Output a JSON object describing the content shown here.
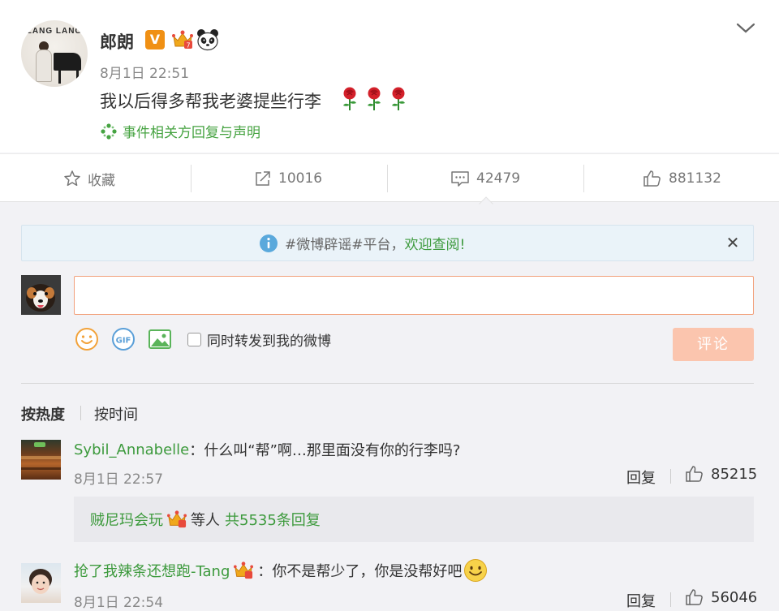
{
  "post": {
    "avatar_brand": "LANG LANG",
    "username": "郎朗",
    "vip_badge": "V",
    "time": "8月1日 22:51",
    "text": "我以后得多帮我老婆提些行李",
    "event_link": "事件相关方回复与声明"
  },
  "actions": {
    "favorite": "收藏",
    "forward": "10016",
    "comment": "42479",
    "like": "881132"
  },
  "notice": {
    "tag": "#微博辟谣#平台，",
    "link": "欢迎查阅!",
    "close": "✕"
  },
  "composer": {
    "input_value": "",
    "repost_label": "同时转发到我的微博",
    "submit": "评论"
  },
  "sort": {
    "hot": "按热度",
    "time": "按时间"
  },
  "comments": [
    {
      "user": "Sybil_Annabelle",
      "separator": "：",
      "text": "什么叫“帮”啊…那里面没有你的行李吗?",
      "time": "8月1日 22:57",
      "reply": "回复",
      "likes": "85215",
      "replies": {
        "user": "贼尼玛会玩",
        "middle": "等人",
        "count_text": "共5535条回复"
      }
    },
    {
      "user": "抢了我辣条还想跑-Tang",
      "separator": "：",
      "text": "你不是帮少了，你是没帮好吧",
      "time": "8月1日 22:54",
      "reply": "回复",
      "likes": "56046"
    }
  ],
  "colors": {
    "green": "#3d9a3d",
    "orange_badge": "#f09014",
    "submit_disabled": "#fbc5ae",
    "input_border": "#f2a07b"
  }
}
